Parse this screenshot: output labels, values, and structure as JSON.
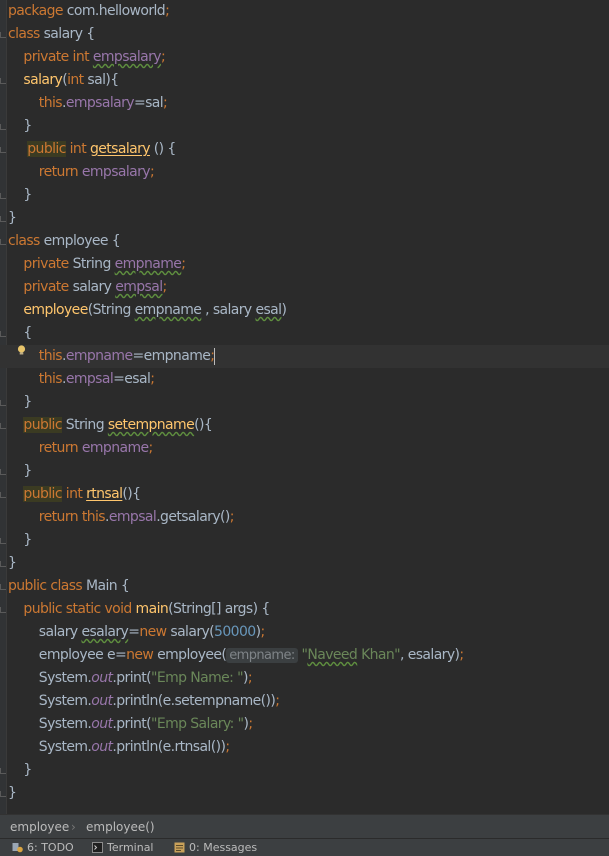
{
  "editor": {
    "lines": [
      [
        {
          "t": "package ",
          "c": "kw"
        },
        {
          "t": "com.helloworld",
          "c": "plain"
        },
        {
          "t": ";",
          "c": "kw"
        }
      ],
      [
        {
          "t": "class ",
          "c": "kw"
        },
        {
          "t": "salary {",
          "c": "plain"
        }
      ],
      [
        {
          "t": "    private int ",
          "c": "kw"
        },
        {
          "t": "empsalary",
          "c": "field warn"
        },
        {
          "t": ";",
          "c": "kw"
        }
      ],
      [
        {
          "t": "    ",
          "c": "plain"
        },
        {
          "t": "salary",
          "c": "method"
        },
        {
          "t": "(",
          "c": "plain"
        },
        {
          "t": "int ",
          "c": "kw"
        },
        {
          "t": "sal){",
          "c": "plain"
        }
      ],
      [
        {
          "t": "        this",
          "c": "kw"
        },
        {
          "t": ".",
          "c": "plain"
        },
        {
          "t": "empsalary",
          "c": "field"
        },
        {
          "t": "=sal",
          "c": "plain"
        },
        {
          "t": ";",
          "c": "kw"
        }
      ],
      [
        {
          "t": "    }",
          "c": "plain"
        }
      ],
      [
        {
          "t": "     ",
          "c": "plain"
        },
        {
          "t": "public",
          "c": "kw hl"
        },
        {
          "t": " int ",
          "c": "kw"
        },
        {
          "t": "getsalary",
          "c": "method ul"
        },
        {
          "t": " () {",
          "c": "plain"
        }
      ],
      [
        {
          "t": "        return ",
          "c": "kw"
        },
        {
          "t": "empsalary",
          "c": "field"
        },
        {
          "t": ";",
          "c": "kw"
        }
      ],
      [
        {
          "t": "    }",
          "c": "plain"
        }
      ],
      [
        {
          "t": "}",
          "c": "plain"
        }
      ],
      [
        {
          "t": "class ",
          "c": "kw"
        },
        {
          "t": "employee {",
          "c": "plain"
        }
      ],
      [
        {
          "t": "    private ",
          "c": "kw"
        },
        {
          "t": "String ",
          "c": "plain"
        },
        {
          "t": "empname",
          "c": "field warn"
        },
        {
          "t": ";",
          "c": "kw"
        }
      ],
      [
        {
          "t": "    private ",
          "c": "kw"
        },
        {
          "t": "salary ",
          "c": "plain"
        },
        {
          "t": "empsal",
          "c": "field warn"
        },
        {
          "t": ";",
          "c": "kw"
        }
      ],
      [
        {
          "t": "    ",
          "c": "plain"
        },
        {
          "t": "employee",
          "c": "method"
        },
        {
          "t": "(String ",
          "c": "plain"
        },
        {
          "t": "empname",
          "c": "plain warn"
        },
        {
          "t": " , salary ",
          "c": "plain"
        },
        {
          "t": "esal",
          "c": "plain warn"
        },
        {
          "t": ")",
          "c": "plain"
        }
      ],
      [
        {
          "t": "    {",
          "c": "plain"
        }
      ],
      [
        {
          "t": "        this",
          "c": "kw"
        },
        {
          "t": ".",
          "c": "plain"
        },
        {
          "t": "empname",
          "c": "field"
        },
        {
          "t": "=empname",
          "c": "plain"
        },
        {
          "t": ";",
          "c": "kw"
        }
      ],
      [
        {
          "t": "        this",
          "c": "kw"
        },
        {
          "t": ".",
          "c": "plain"
        },
        {
          "t": "empsal",
          "c": "field"
        },
        {
          "t": "=esal",
          "c": "plain"
        },
        {
          "t": ";",
          "c": "kw"
        }
      ],
      [
        {
          "t": "    }",
          "c": "plain"
        }
      ],
      [
        {
          "t": "    ",
          "c": "plain"
        },
        {
          "t": "public",
          "c": "kw hl"
        },
        {
          "t": " ",
          "c": "plain"
        },
        {
          "t": "String ",
          "c": "plain"
        },
        {
          "t": "setempname",
          "c": "method warn"
        },
        {
          "t": "(){",
          "c": "plain"
        }
      ],
      [
        {
          "t": "        return ",
          "c": "kw"
        },
        {
          "t": "empname",
          "c": "field"
        },
        {
          "t": ";",
          "c": "kw"
        }
      ],
      [
        {
          "t": "    }",
          "c": "plain"
        }
      ],
      [
        {
          "t": "    ",
          "c": "plain"
        },
        {
          "t": "public",
          "c": "kw hl"
        },
        {
          "t": " int ",
          "c": "kw"
        },
        {
          "t": "rtnsal",
          "c": "method ul"
        },
        {
          "t": "(){",
          "c": "plain"
        }
      ],
      [
        {
          "t": "        return this",
          "c": "kw"
        },
        {
          "t": ".",
          "c": "plain"
        },
        {
          "t": "empsal",
          "c": "field"
        },
        {
          "t": ".getsalary()",
          "c": "plain"
        },
        {
          "t": ";",
          "c": "kw"
        }
      ],
      [
        {
          "t": "    }",
          "c": "plain"
        }
      ],
      [
        {
          "t": "}",
          "c": "plain"
        }
      ],
      [
        {
          "t": "public class ",
          "c": "kw"
        },
        {
          "t": "Main {",
          "c": "plain"
        }
      ],
      [
        {
          "t": "    public static void ",
          "c": "kw"
        },
        {
          "t": "main",
          "c": "method"
        },
        {
          "t": "(String[] args) {",
          "c": "plain"
        }
      ],
      [
        {
          "t": "        salary ",
          "c": "plain"
        },
        {
          "t": "esalary",
          "c": "plain warn"
        },
        {
          "t": "=",
          "c": "plain"
        },
        {
          "t": "new ",
          "c": "kw"
        },
        {
          "t": "salary(",
          "c": "plain"
        },
        {
          "t": "50000",
          "c": "num"
        },
        {
          "t": ")",
          "c": "plain"
        },
        {
          "t": ";",
          "c": "kw"
        }
      ],
      [
        {
          "t": "        employee e=",
          "c": "plain"
        },
        {
          "t": "new ",
          "c": "kw"
        },
        {
          "t": "employee(",
          "c": "plain"
        },
        {
          "t": "empname:",
          "c": "hint"
        },
        {
          "t": " \"",
          "c": "str"
        },
        {
          "t": "Naveed",
          "c": "str warn"
        },
        {
          "t": " Khan\"",
          "c": "str"
        },
        {
          "t": ", esalary)",
          "c": "plain"
        },
        {
          "t": ";",
          "c": "kw"
        }
      ],
      [
        {
          "t": "        System.",
          "c": "plain"
        },
        {
          "t": "out",
          "c": "static"
        },
        {
          "t": ".print(",
          "c": "plain"
        },
        {
          "t": "\"Emp Name: \"",
          "c": "str"
        },
        {
          "t": ")",
          "c": "plain"
        },
        {
          "t": ";",
          "c": "kw"
        }
      ],
      [
        {
          "t": "        System.",
          "c": "plain"
        },
        {
          "t": "out",
          "c": "static"
        },
        {
          "t": ".println(e.setempname())",
          "c": "plain"
        },
        {
          "t": ";",
          "c": "kw"
        }
      ],
      [
        {
          "t": "        System.",
          "c": "plain"
        },
        {
          "t": "out",
          "c": "static"
        },
        {
          "t": ".print(",
          "c": "plain"
        },
        {
          "t": "\"Emp Salary: \"",
          "c": "str"
        },
        {
          "t": ")",
          "c": "plain"
        },
        {
          "t": ";",
          "c": "kw"
        }
      ],
      [
        {
          "t": "        System.",
          "c": "plain"
        },
        {
          "t": "out",
          "c": "static"
        },
        {
          "t": ".println(e.rtnsal())",
          "c": "plain"
        },
        {
          "t": ";",
          "c": "kw"
        }
      ],
      [
        {
          "t": "    }",
          "c": "plain"
        }
      ],
      [
        {
          "t": "}",
          "c": "plain"
        }
      ]
    ]
  },
  "breadcrumb": {
    "items": [
      "employee",
      "employee()"
    ]
  },
  "toolwindows": {
    "todo": "6: TODO",
    "terminal": "Terminal",
    "messages": "0: Messages"
  },
  "icons": {
    "bulb": "lightbulb-icon",
    "todo": "todo-icon",
    "terminal": "terminal-icon",
    "messages": "messages-icon"
  }
}
